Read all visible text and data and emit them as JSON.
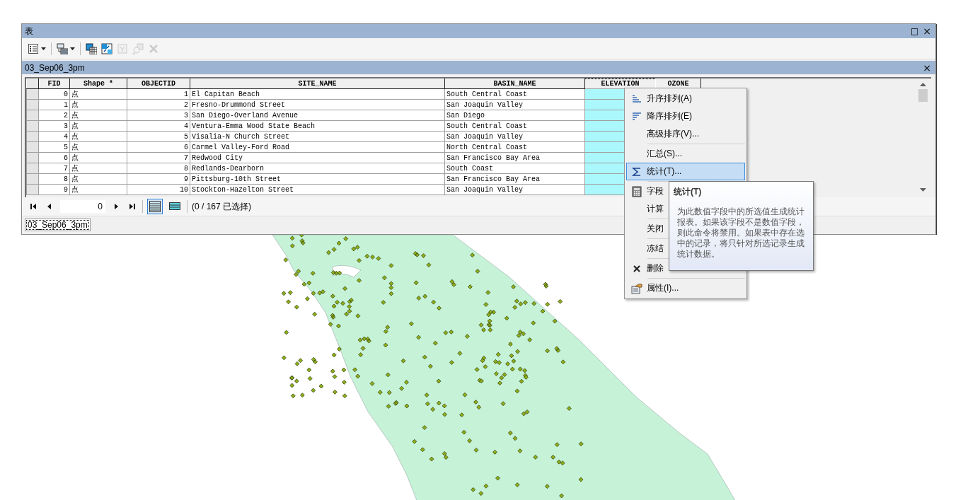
{
  "window": {
    "title": "表",
    "controls": [
      {
        "kind": "maximize",
        "label": "□"
      },
      {
        "kind": "close",
        "label": "×"
      }
    ]
  },
  "toolbar": [
    {
      "kind": "options",
      "dropdown": true,
      "disabled": false
    },
    {
      "kind": "related",
      "dropdown": true,
      "disabled": false
    },
    {
      "kind": "select-by-attributes",
      "dropdown": false,
      "disabled": false
    },
    {
      "kind": "switch-selection",
      "dropdown": false,
      "disabled": false
    },
    {
      "kind": "clear-selection",
      "dropdown": false,
      "disabled": true
    },
    {
      "kind": "zoom-selected",
      "dropdown": false,
      "disabled": true
    },
    {
      "kind": "delete-selected",
      "dropdown": false,
      "disabled": true
    }
  ],
  "table_tab": {
    "title": "03_Sep06_3pm",
    "close": "×"
  },
  "table": {
    "columns": [
      {
        "label": "FID",
        "kind": "number",
        "selected": false
      },
      {
        "label": "Shape *",
        "kind": "text",
        "selected": false
      },
      {
        "label": "OBJECTID",
        "kind": "number",
        "selected": false
      },
      {
        "label": "SITE_NAME",
        "kind": "text",
        "selected": false
      },
      {
        "label": "BASIN_NAME",
        "kind": "text",
        "selected": false
      },
      {
        "label": "ELEVATION",
        "kind": "number",
        "selected": true
      },
      {
        "label": "OZONE",
        "kind": "number",
        "selected": false
      }
    ],
    "rows": [
      {
        "cells": [
          "0",
          "点",
          "1",
          "El Capitan Beach",
          "South Central Coast"
        ]
      },
      {
        "cells": [
          "1",
          "点",
          "2",
          "Fresno-Drummond Street",
          "San Joaquin Valley"
        ]
      },
      {
        "cells": [
          "2",
          "点",
          "3",
          "San Diego-Overland Avenue",
          "San Diego"
        ]
      },
      {
        "cells": [
          "3",
          "点",
          "4",
          "Ventura-Emma Wood State Beach",
          "South Central Coast"
        ]
      },
      {
        "cells": [
          "4",
          "点",
          "5",
          "Visalia-N Church Street",
          "San Joaquin Valley"
        ]
      },
      {
        "cells": [
          "5",
          "点",
          "6",
          "Carmel Valley-Ford Road",
          "North Central Coast"
        ]
      },
      {
        "cells": [
          "6",
          "点",
          "7",
          "Redwood City",
          "San Francisco Bay Area"
        ]
      },
      {
        "cells": [
          "7",
          "点",
          "8",
          "Redlands-Dearborn",
          "South Coast"
        ]
      },
      {
        "cells": [
          "8",
          "点",
          "9",
          "Pittsburg-10th Street",
          "San Francisco Bay Area"
        ]
      },
      {
        "cells": [
          "9",
          "点",
          "10",
          "Stockton-Hazelton Street",
          "San Joaquin Valley"
        ]
      }
    ]
  },
  "navigator": {
    "record": "0",
    "views": [
      {
        "kind": "all",
        "selected": true
      },
      {
        "kind": "selected",
        "selected": false
      }
    ],
    "status": "(0 / 167 已选择)"
  },
  "bottom_tabs": [
    {
      "label": "03_Sep06_3pm",
      "selected": true
    }
  ],
  "context_menu": {
    "groups": [
      [
        {
          "label": "升序排列(A)",
          "selected": false
        },
        {
          "label": "降序排列(E)",
          "selected": false
        },
        {
          "label": "高级排序(V)...",
          "selected": false
        }
      ],
      [
        {
          "label": "汇总(S)...",
          "selected": false
        },
        {
          "label": "统计(T)...",
          "selected": true
        }
      ],
      [
        {
          "label": "字段",
          "selected": false
        },
        {
          "label": "计算",
          "selected": false
        }
      ],
      [
        {
          "label": "关闭",
          "selected": false
        }
      ],
      [
        {
          "label": "冻结",
          "selected": false
        }
      ],
      [
        {
          "label": "删除",
          "selected": false
        }
      ],
      [
        {
          "label": "属性(I)...",
          "selected": false
        }
      ]
    ]
  },
  "tooltip": {
    "title": "统计(T)",
    "text": "为此数值字段中的所选值生成统计报表。如果该字段不是数值字段，则此命令将禁用。如果表中存在选中的记录，将只针对所选记录生成统计数据。"
  }
}
